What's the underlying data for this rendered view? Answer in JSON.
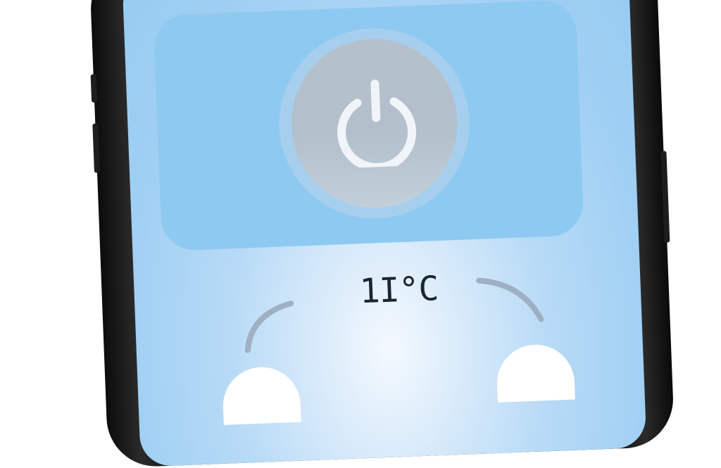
{
  "status_bar": {
    "icon_text": "⁖∿"
  },
  "power": {
    "icon": "power-icon",
    "state": "off"
  },
  "temperature": {
    "display": "1Ι°C"
  },
  "controls": {
    "decrease_icon": "minus-icon",
    "increase_icon": "plus-icon"
  },
  "colors": {
    "screen": "#98cbf1",
    "card": "#8ec9f1",
    "power_button": "#b4c1cd",
    "arc": "#9eb0c1"
  }
}
